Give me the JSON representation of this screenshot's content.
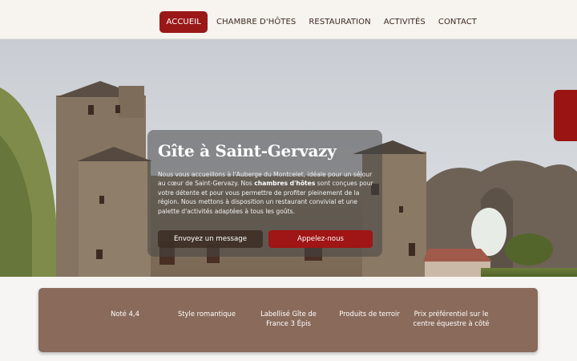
{
  "nav": {
    "items": [
      {
        "label": "ACCUEIL",
        "active": true
      },
      {
        "label": "CHAMBRE D'HÔTES",
        "active": false
      },
      {
        "label": "RESTAURATION",
        "active": false
      },
      {
        "label": "ACTIVITÉS",
        "active": false
      },
      {
        "label": "CONTACT",
        "active": false
      }
    ]
  },
  "hero": {
    "title": "Gîte à Saint-Gervazy",
    "text_before": "Nous vous accueillons à l'Auberge du Montcelet, idéale pour un séjour au cœur de Saint-Gervazy. Nos ",
    "text_bold": "chambres d'hôtes",
    "text_after": " sont conçues pour votre détente et pour vous permettre de profiter pleinement de la région. Nous mettons à disposition un restaurant convivial et une palette d'activités adaptées à tous les goûts.",
    "btn_message": "Envoyez un message",
    "btn_call": "Appelez-nous"
  },
  "features": [
    "Noté 4,4",
    "Style romantique",
    "Labellisé Gîte de France 3 Épis",
    "Produits de terroir",
    "Prix préférentiel sur le centre équestre à côté"
  ],
  "colors": {
    "accent": "#9a1818",
    "header_bg": "#f7f3ef",
    "features_bg": "#8a6a5b"
  }
}
